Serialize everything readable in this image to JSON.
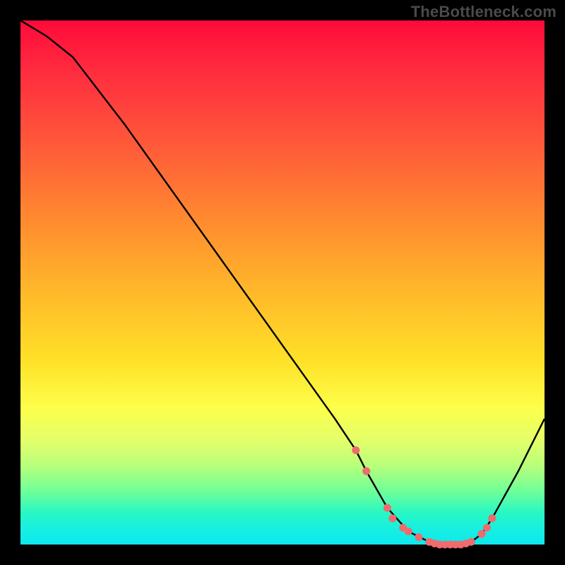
{
  "watermark": "TheBottleneck.com",
  "chart_data": {
    "type": "line",
    "title": "",
    "xlabel": "",
    "ylabel": "",
    "xlim": [
      0,
      100
    ],
    "ylim": [
      0,
      100
    ],
    "series": [
      {
        "name": "curve",
        "x": [
          0,
          5,
          10,
          20,
          30,
          40,
          50,
          60,
          64,
          66,
          70,
          74,
          78,
          80,
          82,
          84,
          86,
          88,
          90,
          95,
          100
        ],
        "y": [
          100,
          97,
          93,
          80,
          66,
          52,
          38,
          24,
          18,
          14,
          7,
          2.5,
          0.5,
          0,
          0,
          0,
          0.5,
          2,
          5,
          14,
          24
        ]
      }
    ],
    "markers": {
      "name": "highlight-dots",
      "color": "#ef6b6e",
      "x": [
        64,
        66,
        70,
        71,
        73,
        74,
        76,
        78,
        79,
        80,
        81,
        82,
        83,
        84,
        85,
        86,
        88,
        89,
        90
      ],
      "y": [
        18,
        14,
        7,
        5,
        3.2,
        2.5,
        1.4,
        0.5,
        0.2,
        0,
        0,
        0,
        0,
        0,
        0.2,
        0.5,
        2,
        3.2,
        5
      ]
    },
    "gradient_stops": [
      {
        "pos": 0.0,
        "color": "#ff0a3a"
      },
      {
        "pos": 0.24,
        "color": "#ff5a3a"
      },
      {
        "pos": 0.52,
        "color": "#ffb92a"
      },
      {
        "pos": 0.74,
        "color": "#fdff4a"
      },
      {
        "pos": 0.9,
        "color": "#6cff9a"
      },
      {
        "pos": 1.0,
        "color": "#0de8ef"
      }
    ]
  }
}
